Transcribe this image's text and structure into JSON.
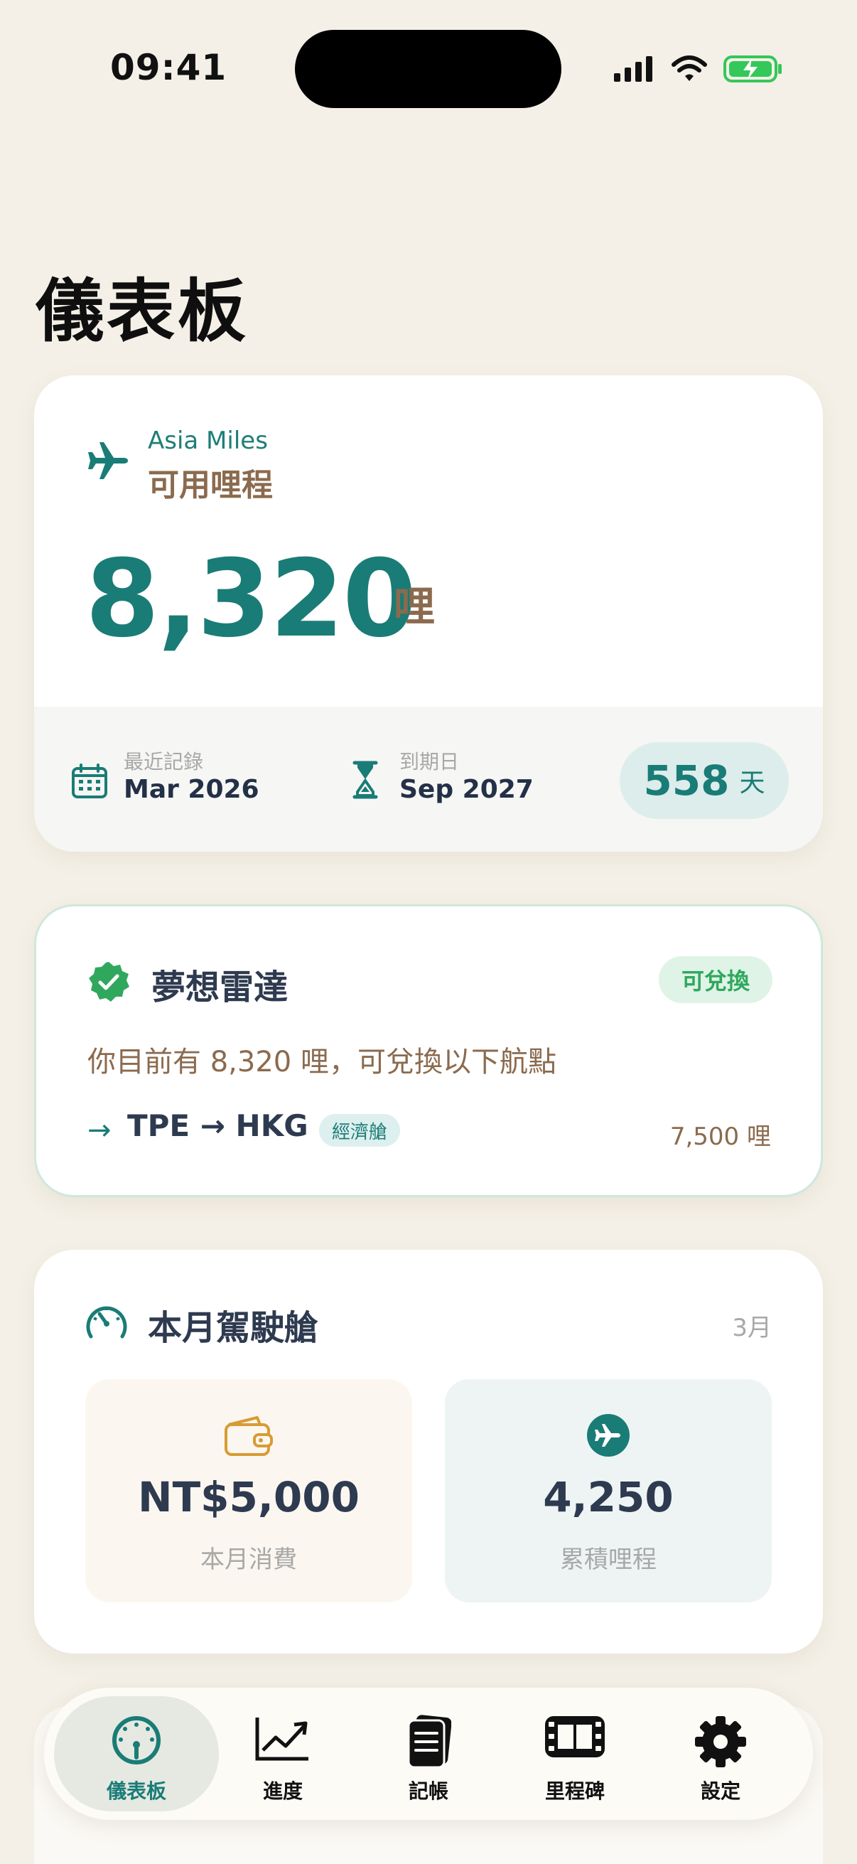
{
  "status_bar": {
    "time": "09:41"
  },
  "page": {
    "title": "儀表板"
  },
  "miles_card": {
    "program": "Asia Miles",
    "label": "可用哩程",
    "value": "8,320",
    "unit": "哩",
    "last_record_label": "最近記錄",
    "last_record_value": "Mar 2026",
    "expiry_label": "到期日",
    "expiry_value": "Sep 2027",
    "days_left": "558",
    "days_unit": "天"
  },
  "dream_radar": {
    "title": "夢想雷達",
    "status": "可兌換",
    "description": "你目前有 8,320 哩，可兌換以下航點",
    "route": "TPE → HKG",
    "cabin_class": "經濟艙",
    "required_miles": "7,500 哩"
  },
  "cockpit": {
    "title": "本月駕駛艙",
    "month": "3月",
    "spend_value": "NT$5,000",
    "spend_label": "本月消費",
    "miles_value": "4,250",
    "miles_label": "累積哩程"
  },
  "tabbar": {
    "items": [
      {
        "label": "儀表板",
        "icon": "gauge-icon",
        "active": true
      },
      {
        "label": "進度",
        "icon": "chart-line-icon",
        "active": false
      },
      {
        "label": "記帳",
        "icon": "notebook-icon",
        "active": false
      },
      {
        "label": "里程碑",
        "icon": "film-icon",
        "active": false
      },
      {
        "label": "設定",
        "icon": "gear-icon",
        "active": false
      }
    ]
  },
  "colors": {
    "accent": "#1A7C76",
    "brown": "#8B6A4E",
    "success": "#2FA85E",
    "background": "#F4F0E7"
  }
}
